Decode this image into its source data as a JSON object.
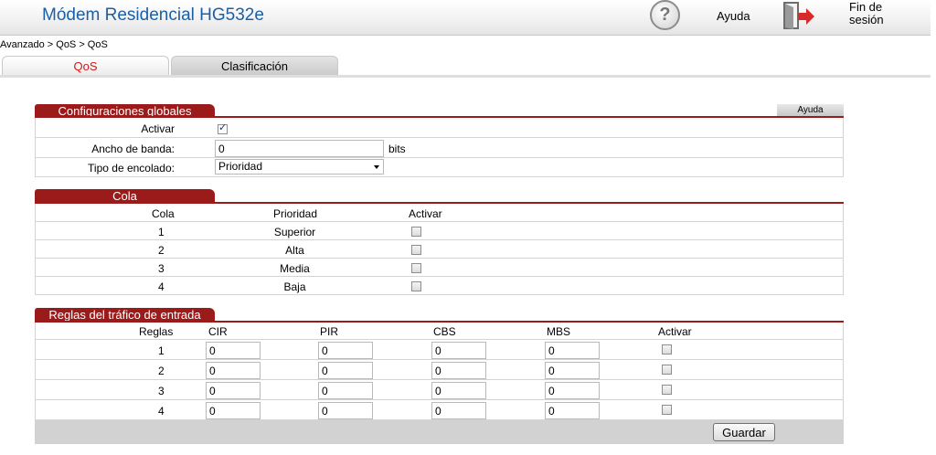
{
  "header": {
    "title": "Módem Residencial HG532e",
    "help_label": "Ayuda",
    "logout_line1": "Fin de",
    "logout_line2": "sesión",
    "help_glyph": "?"
  },
  "breadcrumb": "Avanzado > QoS > QoS",
  "tabs": [
    {
      "label": "QoS",
      "active": true
    },
    {
      "label": "Clasificación",
      "active": false
    }
  ],
  "global": {
    "title": "Configuraciones globales",
    "help_button": "Ayuda",
    "enable_label": "Activar",
    "enable_checked": true,
    "bandwidth_label": "Ancho de banda:",
    "bandwidth_value": "0",
    "bandwidth_unit": "bits",
    "queue_type_label": "Tipo de encolado:",
    "queue_type_value": "Prioridad"
  },
  "queue": {
    "title": "Cola",
    "headers": [
      "Cola",
      "Prioridad",
      "Activar"
    ],
    "rows": [
      {
        "id": "1",
        "priority": "Superior",
        "enabled": false
      },
      {
        "id": "2",
        "priority": "Alta",
        "enabled": false
      },
      {
        "id": "3",
        "priority": "Media",
        "enabled": false
      },
      {
        "id": "4",
        "priority": "Baja",
        "enabled": false
      }
    ]
  },
  "ingress": {
    "title": "Reglas del tráfico de entrada",
    "headers": [
      "Reglas",
      "CIR",
      "PIR",
      "CBS",
      "MBS",
      "Activar"
    ],
    "rows": [
      {
        "id": "1",
        "cir": "0",
        "pir": "0",
        "cbs": "0",
        "mbs": "0",
        "enabled": false
      },
      {
        "id": "2",
        "cir": "0",
        "pir": "0",
        "cbs": "0",
        "mbs": "0",
        "enabled": false
      },
      {
        "id": "3",
        "cir": "0",
        "pir": "0",
        "cbs": "0",
        "mbs": "0",
        "enabled": false
      },
      {
        "id": "4",
        "cir": "0",
        "pir": "0",
        "cbs": "0",
        "mbs": "0",
        "enabled": false
      }
    ]
  },
  "save_label": "Guardar",
  "colors": {
    "accent": "#9b1b1b",
    "title": "#1b5fa6",
    "active_tab": "#cc1b1b"
  }
}
